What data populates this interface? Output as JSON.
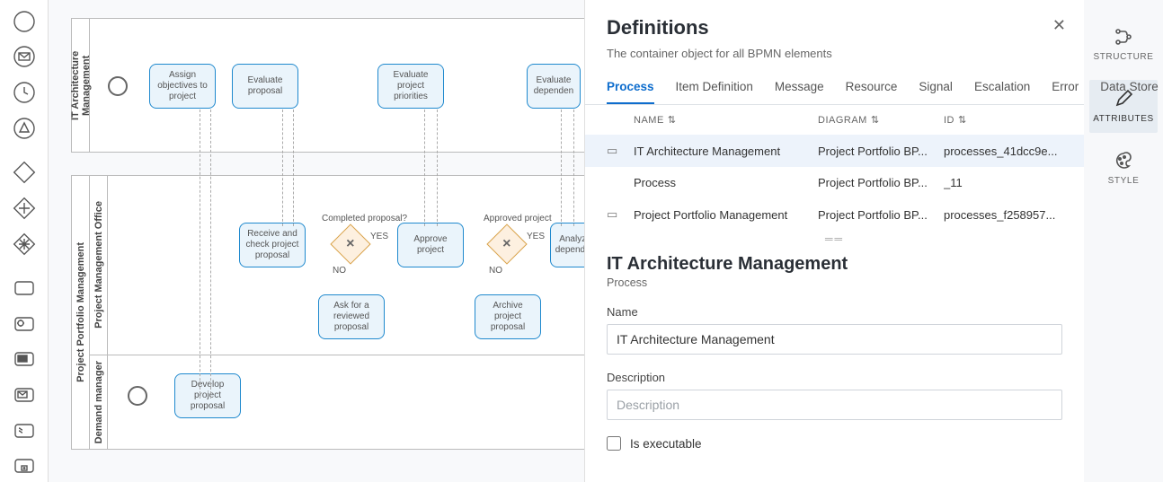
{
  "palette": {
    "items": [
      "circle-icon",
      "envelope-icon",
      "clock-icon",
      "triangle-icon",
      "diamond-icon",
      "plus-diamond-icon",
      "complex-diamond-icon",
      "square-icon",
      "gear-icon",
      "mail-icon",
      "receive-icon",
      "script-icon",
      "folder-icon"
    ]
  },
  "canvas": {
    "pool1": {
      "title": "IT Architecture Management",
      "tasks": {
        "assign": "Assign objectives to project",
        "evaluate": "Evaluate proposal",
        "priorities": "Evaluate project priorities",
        "depend": "Evaluate dependen"
      }
    },
    "pool2": {
      "title": "Project Portfolio Management",
      "lane1": {
        "title": "Project Management Office",
        "labels": {
          "completed": "Completed proposal?",
          "approved": "Approved project",
          "yes": "YES",
          "no": "NO"
        },
        "tasks": {
          "receive": "Receive and check project proposal",
          "approve": "Approve project",
          "analyze": "Analyze dependen",
          "ask": "Ask for a reviewed proposal",
          "archive": "Archive project proposal"
        }
      },
      "lane2": {
        "title": "Demand manager",
        "tasks": {
          "develop": "Develop project proposal"
        }
      }
    }
  },
  "props": {
    "title": "Definitions",
    "subtitle": "The container object for all BPMN elements",
    "tabs": [
      "Process",
      "Item Definition",
      "Message",
      "Resource",
      "Signal",
      "Escalation",
      "Error",
      "Data Store"
    ],
    "columns": {
      "name": "NAME",
      "diagram": "DIAGRAM",
      "id": "ID"
    },
    "rows": [
      {
        "icon": true,
        "name": "IT Architecture Management",
        "diagram": "Project Portfolio BP...",
        "id": "processes_41dcc9e...",
        "selected": true
      },
      {
        "icon": false,
        "name": "Process",
        "diagram": "Project Portfolio BP...",
        "id": "_11",
        "selected": false
      },
      {
        "icon": true,
        "name": "Project Portfolio Management",
        "diagram": "Project Portfolio BP...",
        "id": "processes_f258957...",
        "selected": false
      }
    ],
    "detail": {
      "heading": "IT Architecture Management",
      "kind": "Process",
      "name_label": "Name",
      "name_value": "IT Architecture Management",
      "desc_label": "Description",
      "desc_placeholder": "Description",
      "exec_label": "Is executable",
      "exec_checked": false
    }
  },
  "rail": {
    "items": [
      {
        "label": "STRUCTURE",
        "icon": "branch-icon",
        "active": false
      },
      {
        "label": "ATTRIBUTES",
        "icon": "pencil-icon",
        "active": true
      },
      {
        "label": "STYLE",
        "icon": "palette-icon",
        "active": false
      }
    ]
  }
}
